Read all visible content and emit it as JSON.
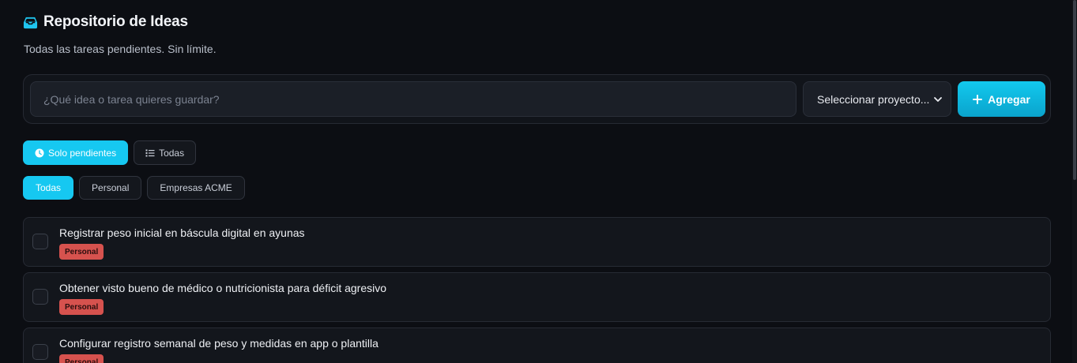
{
  "header": {
    "title": "Repositorio de Ideas",
    "subtitle": "Todas las tareas pendientes. Sin límite.",
    "icon": "inbox-icon"
  },
  "composer": {
    "placeholder": "¿Qué idea o tarea quieres guardar?",
    "value": "",
    "project_select": "Seleccionar proyecto...",
    "add_label": "Agregar"
  },
  "status_filters": [
    {
      "label": "Solo pendientes",
      "icon": "clock-icon",
      "active": true
    },
    {
      "label": "Todas",
      "icon": "list-icon",
      "active": false
    }
  ],
  "project_filters": [
    {
      "label": "Todas",
      "active": true
    },
    {
      "label": "Personal",
      "active": false
    },
    {
      "label": "Empresas ACME",
      "active": false
    }
  ],
  "tasks": [
    {
      "text": "Registrar peso inicial en báscula digital en ayunas",
      "tag": "Personal",
      "done": false
    },
    {
      "text": "Obtener visto bueno de médico o nutricionista para déficit agresivo",
      "tag": "Personal",
      "done": false
    },
    {
      "text": "Configurar registro semanal de peso y medidas en app o plantilla",
      "tag": "Personal",
      "done": false
    }
  ],
  "colors": {
    "accent": "#16c8f1",
    "background": "#0c0e13",
    "card": "#13161c",
    "tag_personal": "#d6524e"
  }
}
